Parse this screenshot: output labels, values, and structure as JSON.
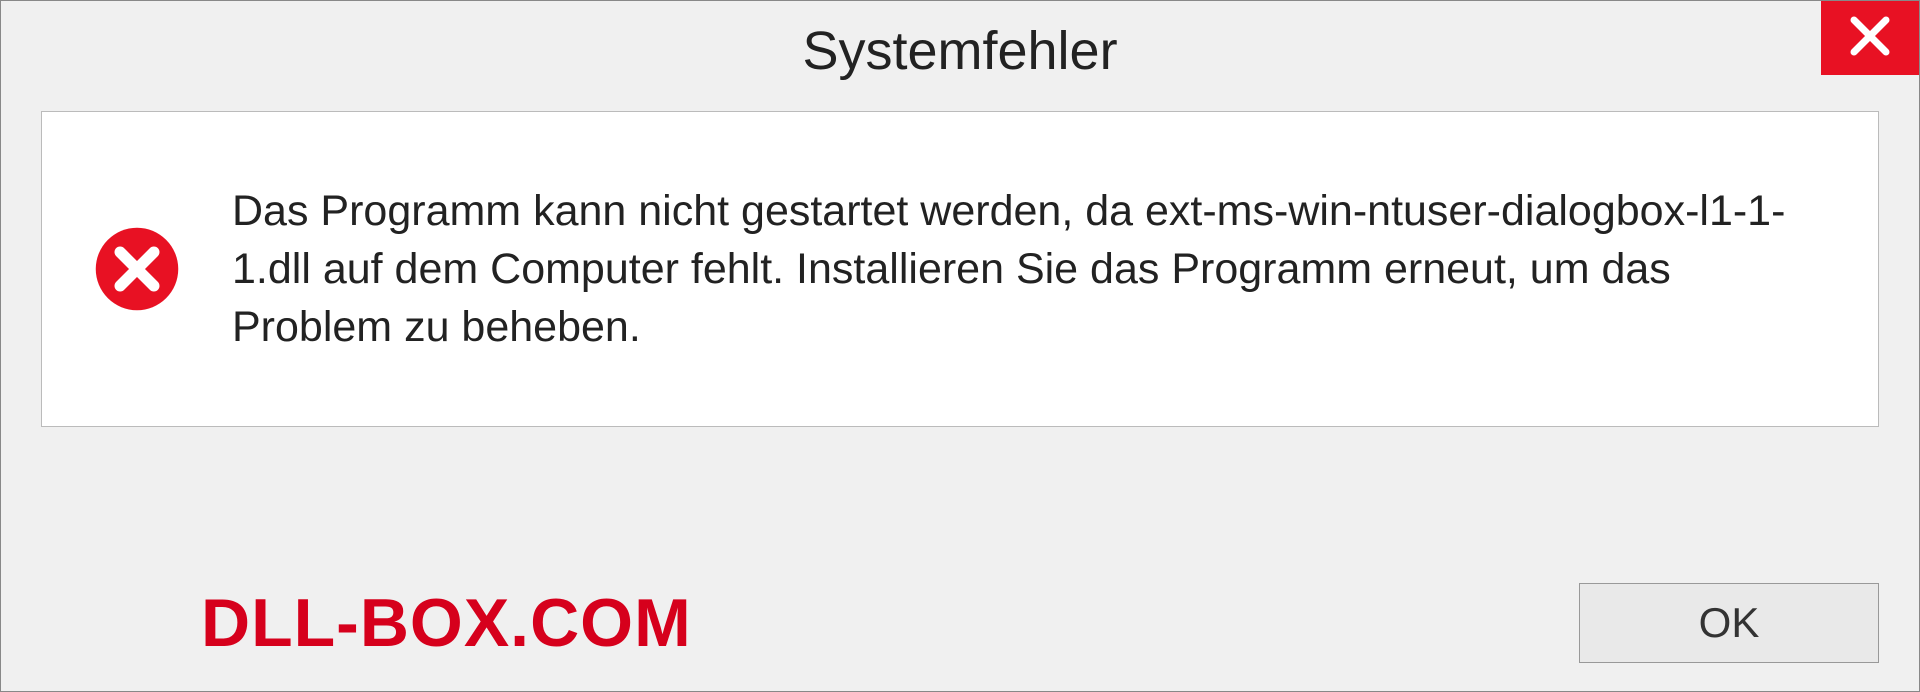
{
  "dialog": {
    "title": "Systemfehler",
    "message": "Das Programm kann nicht gestartet werden, da ext-ms-win-ntuser-dialogbox-l1-1-1.dll auf dem Computer fehlt. Installieren Sie das Programm erneut, um das Problem zu beheben.",
    "ok_label": "OK"
  },
  "watermark": "DLL-BOX.COM"
}
